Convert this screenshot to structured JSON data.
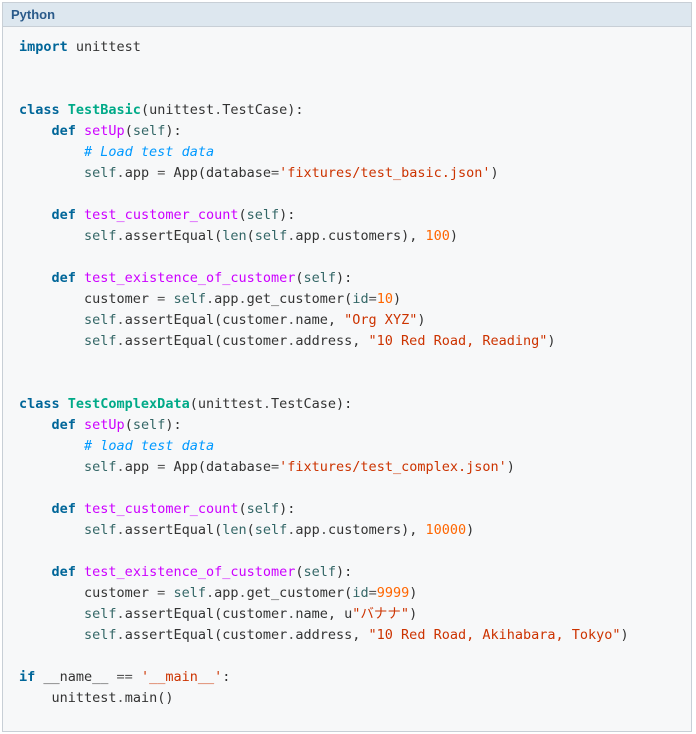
{
  "header": {
    "label": "Python"
  },
  "tokens": [
    [
      [
        "kw",
        "import"
      ],
      [
        "pun",
        " unittest"
      ]
    ],
    [],
    [],
    [
      [
        "kw",
        "class"
      ],
      [
        "pun",
        " "
      ],
      [
        "cls",
        "TestBasic"
      ],
      [
        "pun",
        "(unittest"
      ],
      [
        "op",
        "."
      ],
      [
        "pun",
        "TestCase):"
      ]
    ],
    [
      [
        "pun",
        "    "
      ],
      [
        "kw",
        "def"
      ],
      [
        "pun",
        " "
      ],
      [
        "fn",
        "setUp"
      ],
      [
        "pun",
        "("
      ],
      [
        "bi",
        "self"
      ],
      [
        "pun",
        "):"
      ]
    ],
    [
      [
        "pun",
        "        "
      ],
      [
        "cmt",
        "# Load test data"
      ]
    ],
    [
      [
        "pun",
        "        "
      ],
      [
        "bi",
        "self"
      ],
      [
        "op",
        "."
      ],
      [
        "pun",
        "app "
      ],
      [
        "op",
        "="
      ],
      [
        "pun",
        " App(database"
      ],
      [
        "op",
        "="
      ],
      [
        "str",
        "'fixtures/test_basic.json'"
      ],
      [
        "pun",
        ")"
      ]
    ],
    [],
    [
      [
        "pun",
        "    "
      ],
      [
        "kw",
        "def"
      ],
      [
        "pun",
        " "
      ],
      [
        "fn",
        "test_customer_count"
      ],
      [
        "pun",
        "("
      ],
      [
        "bi",
        "self"
      ],
      [
        "pun",
        "):"
      ]
    ],
    [
      [
        "pun",
        "        "
      ],
      [
        "bi",
        "self"
      ],
      [
        "op",
        "."
      ],
      [
        "pun",
        "assertEqual("
      ],
      [
        "bi",
        "len"
      ],
      [
        "pun",
        "("
      ],
      [
        "bi",
        "self"
      ],
      [
        "op",
        "."
      ],
      [
        "pun",
        "app"
      ],
      [
        "op",
        "."
      ],
      [
        "pun",
        "customers), "
      ],
      [
        "num",
        "100"
      ],
      [
        "pun",
        ")"
      ]
    ],
    [],
    [
      [
        "pun",
        "    "
      ],
      [
        "kw",
        "def"
      ],
      [
        "pun",
        " "
      ],
      [
        "fn",
        "test_existence_of_customer"
      ],
      [
        "pun",
        "("
      ],
      [
        "bi",
        "self"
      ],
      [
        "pun",
        "):"
      ]
    ],
    [
      [
        "pun",
        "        customer "
      ],
      [
        "op",
        "="
      ],
      [
        "pun",
        " "
      ],
      [
        "bi",
        "self"
      ],
      [
        "op",
        "."
      ],
      [
        "pun",
        "app"
      ],
      [
        "op",
        "."
      ],
      [
        "pun",
        "get_customer("
      ],
      [
        "bi",
        "id"
      ],
      [
        "op",
        "="
      ],
      [
        "num",
        "10"
      ],
      [
        "pun",
        ")"
      ]
    ],
    [
      [
        "pun",
        "        "
      ],
      [
        "bi",
        "self"
      ],
      [
        "op",
        "."
      ],
      [
        "pun",
        "assertEqual(customer"
      ],
      [
        "op",
        "."
      ],
      [
        "pun",
        "name, "
      ],
      [
        "str",
        "\"Org XYZ\""
      ],
      [
        "pun",
        ")"
      ]
    ],
    [
      [
        "pun",
        "        "
      ],
      [
        "bi",
        "self"
      ],
      [
        "op",
        "."
      ],
      [
        "pun",
        "assertEqual(customer"
      ],
      [
        "op",
        "."
      ],
      [
        "pun",
        "address, "
      ],
      [
        "str",
        "\"10 Red Road, Reading\""
      ],
      [
        "pun",
        ")"
      ]
    ],
    [],
    [],
    [
      [
        "kw",
        "class"
      ],
      [
        "pun",
        " "
      ],
      [
        "cls",
        "TestComplexData"
      ],
      [
        "pun",
        "(unittest"
      ],
      [
        "op",
        "."
      ],
      [
        "pun",
        "TestCase):"
      ]
    ],
    [
      [
        "pun",
        "    "
      ],
      [
        "kw",
        "def"
      ],
      [
        "pun",
        " "
      ],
      [
        "fn",
        "setUp"
      ],
      [
        "pun",
        "("
      ],
      [
        "bi",
        "self"
      ],
      [
        "pun",
        "):"
      ]
    ],
    [
      [
        "pun",
        "        "
      ],
      [
        "cmt",
        "# load test data"
      ]
    ],
    [
      [
        "pun",
        "        "
      ],
      [
        "bi",
        "self"
      ],
      [
        "op",
        "."
      ],
      [
        "pun",
        "app "
      ],
      [
        "op",
        "="
      ],
      [
        "pun",
        " App(database"
      ],
      [
        "op",
        "="
      ],
      [
        "str",
        "'fixtures/test_complex.json'"
      ],
      [
        "pun",
        ")"
      ]
    ],
    [],
    [
      [
        "pun",
        "    "
      ],
      [
        "kw",
        "def"
      ],
      [
        "pun",
        " "
      ],
      [
        "fn",
        "test_customer_count"
      ],
      [
        "pun",
        "("
      ],
      [
        "bi",
        "self"
      ],
      [
        "pun",
        "):"
      ]
    ],
    [
      [
        "pun",
        "        "
      ],
      [
        "bi",
        "self"
      ],
      [
        "op",
        "."
      ],
      [
        "pun",
        "assertEqual("
      ],
      [
        "bi",
        "len"
      ],
      [
        "pun",
        "("
      ],
      [
        "bi",
        "self"
      ],
      [
        "op",
        "."
      ],
      [
        "pun",
        "app"
      ],
      [
        "op",
        "."
      ],
      [
        "pun",
        "customers), "
      ],
      [
        "num",
        "10000"
      ],
      [
        "pun",
        ")"
      ]
    ],
    [],
    [
      [
        "pun",
        "    "
      ],
      [
        "kw",
        "def"
      ],
      [
        "pun",
        " "
      ],
      [
        "fn",
        "test_existence_of_customer"
      ],
      [
        "pun",
        "("
      ],
      [
        "bi",
        "self"
      ],
      [
        "pun",
        "):"
      ]
    ],
    [
      [
        "pun",
        "        customer "
      ],
      [
        "op",
        "="
      ],
      [
        "pun",
        " "
      ],
      [
        "bi",
        "self"
      ],
      [
        "op",
        "."
      ],
      [
        "pun",
        "app"
      ],
      [
        "op",
        "."
      ],
      [
        "pun",
        "get_customer("
      ],
      [
        "bi",
        "id"
      ],
      [
        "op",
        "="
      ],
      [
        "num",
        "9999"
      ],
      [
        "pun",
        ")"
      ]
    ],
    [
      [
        "pun",
        "        "
      ],
      [
        "bi",
        "self"
      ],
      [
        "op",
        "."
      ],
      [
        "pun",
        "assertEqual(customer"
      ],
      [
        "op",
        "."
      ],
      [
        "pun",
        "name, u"
      ],
      [
        "str",
        "\"バナナ\""
      ],
      [
        "pun",
        ")"
      ]
    ],
    [
      [
        "pun",
        "        "
      ],
      [
        "bi",
        "self"
      ],
      [
        "op",
        "."
      ],
      [
        "pun",
        "assertEqual(customer"
      ],
      [
        "op",
        "."
      ],
      [
        "pun",
        "address, "
      ],
      [
        "str",
        "\"10 Red Road, Akihabara, Tokyo\""
      ],
      [
        "pun",
        ")"
      ]
    ],
    [],
    [
      [
        "kw",
        "if"
      ],
      [
        "pun",
        " __name__ "
      ],
      [
        "op",
        "=="
      ],
      [
        "pun",
        " "
      ],
      [
        "str",
        "'__main__'"
      ],
      [
        "pun",
        ":"
      ]
    ],
    [
      [
        "pun",
        "    unittest"
      ],
      [
        "op",
        "."
      ],
      [
        "pun",
        "main()"
      ]
    ]
  ]
}
